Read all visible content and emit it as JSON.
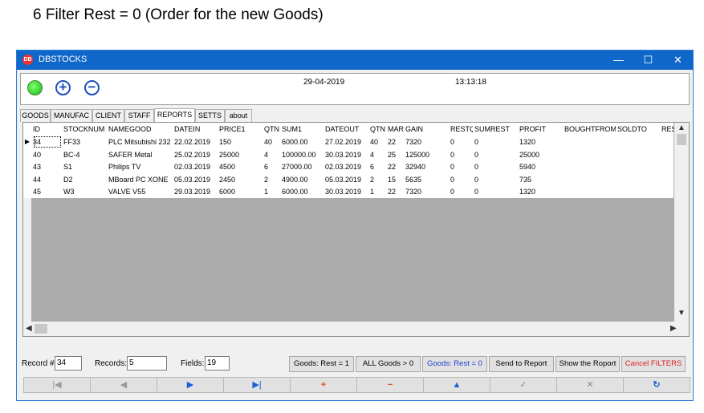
{
  "caption": "6 Filter Rest = 0 (Order for the new Goods)",
  "window": {
    "title": "DBSTOCKS",
    "minimize": "—",
    "maximize": "☐",
    "close": "✕"
  },
  "header": {
    "date": "29-04-2019",
    "time": "13:13:18"
  },
  "tabs": [
    "GOODS",
    "MANUFAC",
    "CLIENT",
    "STAFF",
    "REPORTS",
    "SETTS",
    "about"
  ],
  "active_tab": "REPORTS",
  "table": {
    "columns": [
      "ID",
      "STOCKNUM",
      "NAMEGOOD",
      "DATEIN",
      "PRICE1",
      "QTN",
      "SUM1",
      "DATEOUT",
      "QTN",
      "MAR",
      "GAIN",
      "RESTQ",
      "SUMREST",
      "PROFIT",
      "BOUGHTFROM",
      "SOLDTO",
      "RESE"
    ],
    "rows": [
      [
        "34",
        "FF33",
        "PLC Mitsubishi 232",
        "22.02.2019",
        "150",
        "40",
        "6000.00",
        "27.02.2019",
        "40",
        "22",
        "7320",
        "0",
        "0",
        "1320",
        "",
        "",
        ""
      ],
      [
        "40",
        "BC-4",
        "SAFER Metal",
        "25.02.2019",
        "25000",
        "4",
        "100000.00",
        "30.03.2019",
        "4",
        "25",
        "125000",
        "0",
        "0",
        "25000",
        "",
        "",
        ""
      ],
      [
        "43",
        "S1",
        "Philips TV",
        "02.03.2019",
        "4500",
        "6",
        "27000.00",
        "02.03.2019",
        "6",
        "22",
        "32940",
        "0",
        "0",
        "5940",
        "",
        "",
        ""
      ],
      [
        "44",
        "D2",
        "MBoard PC XONE",
        "05.03.2019",
        "2450",
        "2",
        "4900.00",
        "05.03.2019",
        "2",
        "15",
        "5635",
        "0",
        "0",
        "735",
        "",
        "",
        ""
      ],
      [
        "45",
        "W3",
        "VALVE V55",
        "29.03.2019",
        "6000",
        "1",
        "6000.00",
        "30.03.2019",
        "1",
        "22",
        "7320",
        "0",
        "0",
        "1320",
        "",
        "",
        ""
      ]
    ]
  },
  "footer": {
    "record_label": "Record #",
    "record_value": "34",
    "records_label": "Records:",
    "records_value": "5",
    "fields_label": "Fields:",
    "fields_value": "19",
    "btn_rest1": "Goods: Rest = 1",
    "btn_all": "ALL Goods > 0",
    "btn_rest0": "Goods: Rest = 0",
    "btn_send": "Send to Report",
    "btn_show": "Show the Roport",
    "btn_cancel": "Cancel FILTERS"
  },
  "nav_icons": [
    "first-icon",
    "prior-icon",
    "next-icon",
    "last-icon",
    "insert-icon",
    "delete-icon",
    "edit-icon",
    "post-icon",
    "cancel-icon",
    "refresh-icon"
  ],
  "colors": {
    "titlebar": "#0f67c9",
    "rest0_text": "#1b3fd6",
    "cancel_text": "#e02020",
    "nav_arrow": "#1a5fd6",
    "nav_plus": "#e0501b"
  }
}
